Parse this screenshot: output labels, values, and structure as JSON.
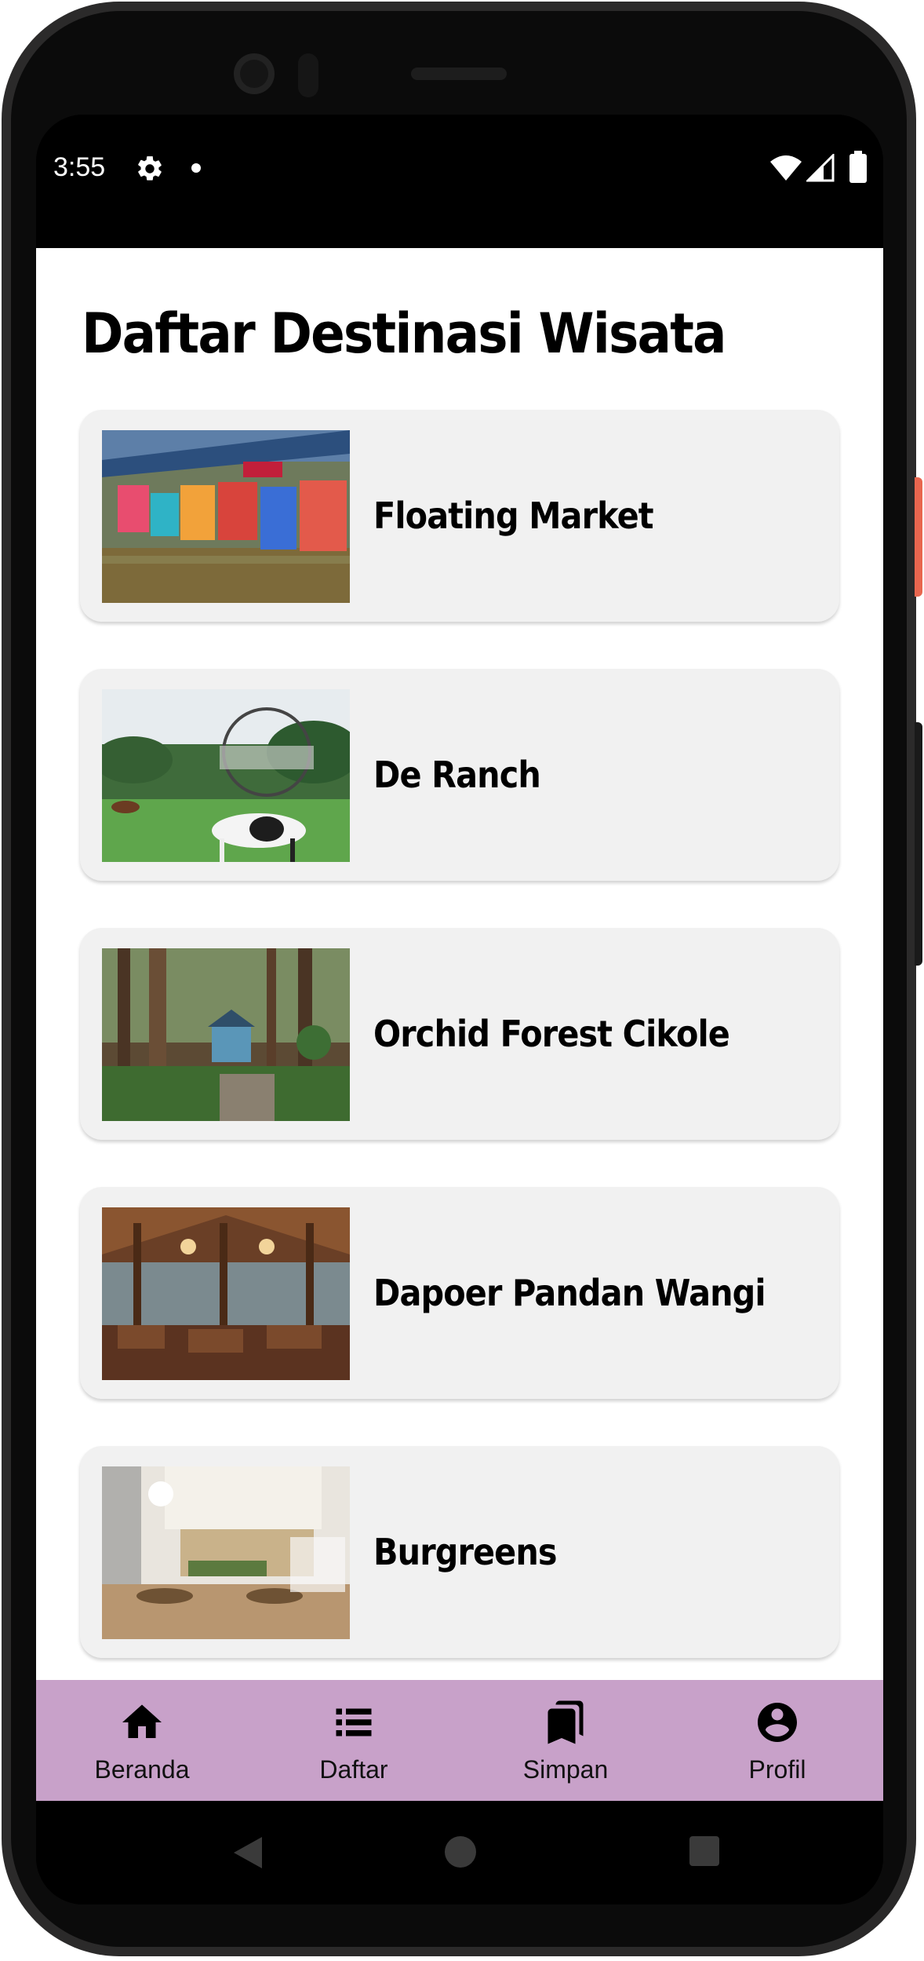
{
  "status_bar": {
    "time": "3:55",
    "icons": [
      "settings-gear-icon",
      "notification-dot-icon",
      "wifi-icon",
      "cellular-signal-icon",
      "battery-icon"
    ]
  },
  "page": {
    "title": "Daftar Destinasi Wisata"
  },
  "destinations": [
    {
      "name": "Floating Market",
      "image": "floating-market-photo"
    },
    {
      "name": "De Ranch",
      "image": "de-ranch-photo"
    },
    {
      "name": "Orchid Forest Cikole",
      "image": "orchid-forest-photo"
    },
    {
      "name": "Dapoer Pandan Wangi",
      "image": "dapoer-pandan-wangi-photo"
    },
    {
      "name": "Burgreens",
      "image": "burgreens-photo"
    }
  ],
  "bottom_nav": {
    "background": "#c8a1c9",
    "items": [
      {
        "label": "Beranda",
        "icon": "home-icon"
      },
      {
        "label": "Daftar",
        "icon": "list-icon"
      },
      {
        "label": "Simpan",
        "icon": "bookmarks-icon"
      },
      {
        "label": "Profil",
        "icon": "account-circle-icon"
      }
    ]
  },
  "system_nav": {
    "buttons": [
      "back-triangle-icon",
      "home-circle-icon",
      "recents-square-icon"
    ]
  }
}
